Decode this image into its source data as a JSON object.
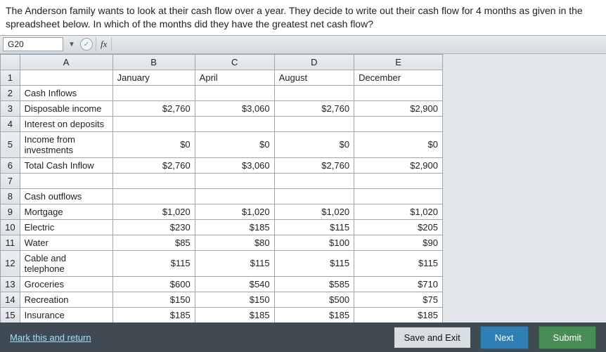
{
  "question": "The Anderson family wants to look at their cash flow over a year. They decide to write out their cash flow for 4 months as given in the spreadsheet below. In which of the months did they have the greatest net cash flow?",
  "toolbar": {
    "cell_ref": "G20",
    "fx_label": "fx"
  },
  "cols": {
    "a": "A",
    "b": "B",
    "c": "C",
    "d": "D",
    "e": "E"
  },
  "rows": {
    "r1": {
      "num": "1",
      "label": "",
      "b": "January",
      "c": "April",
      "d": "August",
      "e": "December"
    },
    "r2": {
      "num": "2",
      "label": "Cash Inflows"
    },
    "r3": {
      "num": "3",
      "label": "Disposable income",
      "b": "$2,760",
      "c": "$3,060",
      "d": "$2,760",
      "e": "$2,900"
    },
    "r4": {
      "num": "4",
      "label": "Interest on deposits"
    },
    "r5": {
      "num": "5",
      "label": "Income from investments",
      "b": "$0",
      "c": "$0",
      "d": "$0",
      "e": "$0"
    },
    "r6": {
      "num": "6",
      "label": "Total Cash Inflow",
      "b": "$2,760",
      "c": "$3,060",
      "d": "$2,760",
      "e": "$2,900"
    },
    "r7": {
      "num": "7",
      "label": ""
    },
    "r8": {
      "num": "8",
      "label": "Cash outflows"
    },
    "r9": {
      "num": "9",
      "label": "Mortgage",
      "b": "$1,020",
      "c": "$1,020",
      "d": "$1,020",
      "e": "$1,020"
    },
    "r10": {
      "num": "10",
      "label": "Electric",
      "b": "$230",
      "c": "$185",
      "d": "$115",
      "e": "$205"
    },
    "r11": {
      "num": "11",
      "label": "Water",
      "b": "$85",
      "c": "$80",
      "d": "$100",
      "e": "$90"
    },
    "r12": {
      "num": "12",
      "label": "Cable and telephone",
      "b": "$115",
      "c": "$115",
      "d": "$115",
      "e": "$115"
    },
    "r13": {
      "num": "13",
      "label": "Groceries",
      "b": "$600",
      "c": "$540",
      "d": "$585",
      "e": "$710"
    },
    "r14": {
      "num": "14",
      "label": "Recreation",
      "b": "$150",
      "c": "$150",
      "d": "$500",
      "e": "$75"
    },
    "r15": {
      "num": "15",
      "label": "Insurance",
      "b": "$185",
      "c": "$185",
      "d": "$185",
      "e": "$185"
    }
  },
  "footer": {
    "mark": "Mark this and return",
    "save_exit": "Save and Exit",
    "next": "Next",
    "submit": "Submit"
  }
}
